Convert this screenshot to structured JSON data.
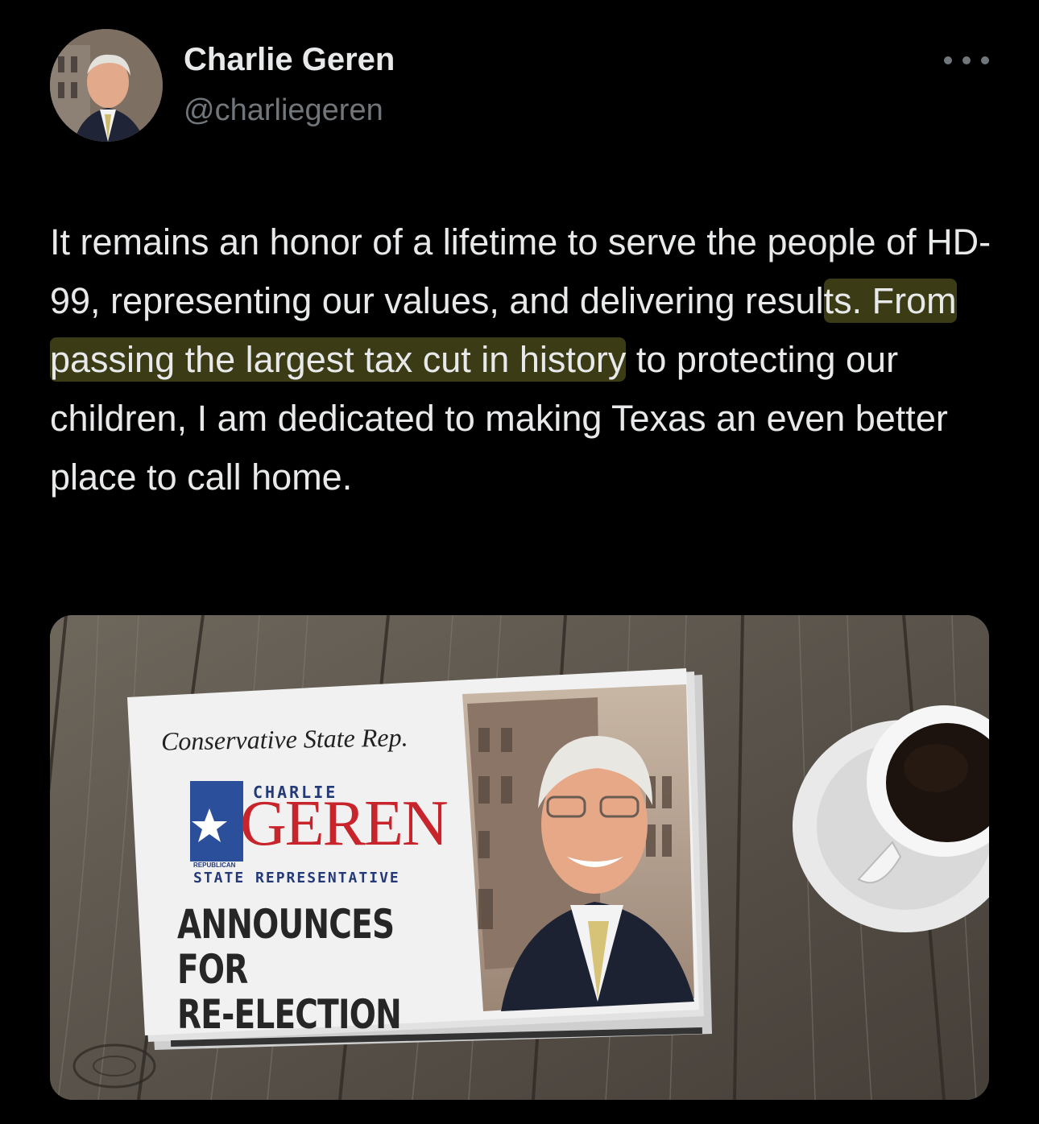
{
  "author": {
    "name": "Charlie Geren",
    "handle": "@charliegeren"
  },
  "tweet": {
    "text_before": "It remains an honor of a lifetime to serve the people of HD-99, representing our values, and delivering resul",
    "text_highlight": "ts. From passing the largest tax cut in history",
    "text_after": " to protecting our children, I am dedicated to making Texas an even better place to call home."
  },
  "media": {
    "kicker": "Conservative State Rep.",
    "logo_first": "CHARLIE",
    "logo_last": "GEREN",
    "logo_party": "REPUBLICAN",
    "logo_title": "STATE REPRESENTATIVE",
    "headline_line1": "ANNOUNCES FOR",
    "headline_line2": "RE-ELECTION"
  },
  "colors": {
    "background": "#000000",
    "text": "#e7e9ea",
    "secondary": "#71767b",
    "highlight": "#a8aa3c",
    "logo_red": "#c8242b",
    "logo_blue": "#243a78"
  },
  "icons": {
    "more": "more-dots-icon"
  }
}
